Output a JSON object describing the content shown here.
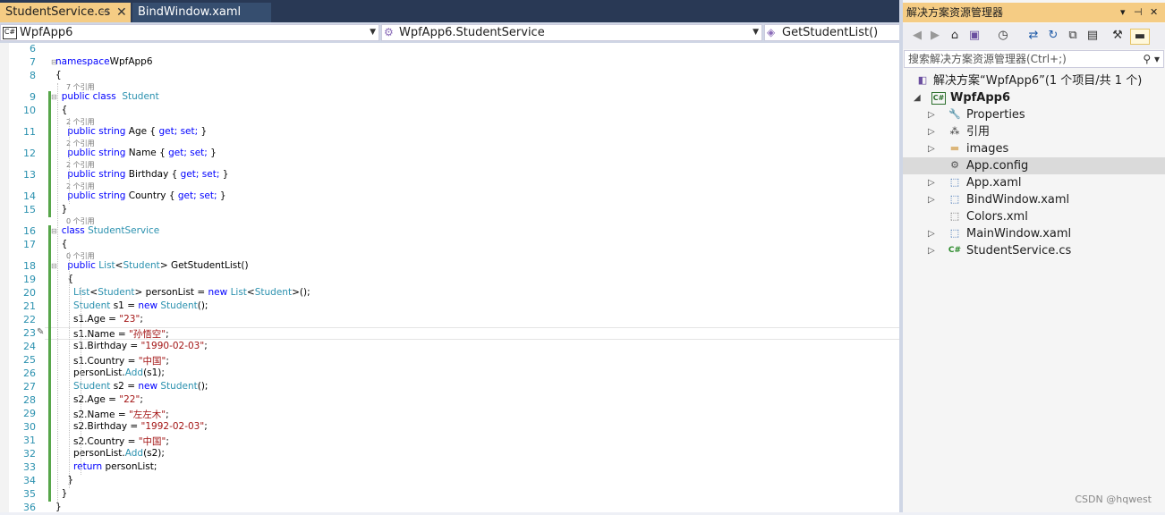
{
  "tabs": [
    {
      "label": "StudentService.cs",
      "active": true
    },
    {
      "label": "BindWindow.xaml",
      "active": false
    }
  ],
  "nav": {
    "project": "WpfApp6",
    "class": "WpfApp6.StudentService",
    "member": "GetStudentList()"
  },
  "lines": [
    {
      "n": "6",
      "tokens": []
    },
    {
      "n": "7",
      "tokens": [
        [
          "kw",
          "namespace"
        ],
        [
          "",
          "WpfApp6"
        ]
      ]
    },
    {
      "n": "8",
      "tokens": [
        [
          "",
          "{"
        ]
      ]
    },
    {
      "ref": "7 个引用"
    },
    {
      "n": "9",
      "tokens": [
        [
          "",
          "  "
        ],
        [
          "kw",
          "public class"
        ],
        [
          "",
          "  "
        ],
        [
          "ty",
          "Student"
        ]
      ]
    },
    {
      "n": "10",
      "tokens": [
        [
          "",
          "  {"
        ]
      ]
    },
    {
      "ref": "2 个引用"
    },
    {
      "n": "11",
      "tokens": [
        [
          "",
          "    "
        ],
        [
          "kw",
          "public string"
        ],
        [
          "",
          " Age { "
        ],
        [
          "kw",
          "get; set;"
        ],
        [
          "",
          " }"
        ]
      ]
    },
    {
      "ref": "2 个引用"
    },
    {
      "n": "12",
      "tokens": [
        [
          "",
          "    "
        ],
        [
          "kw",
          "public string"
        ],
        [
          "",
          " Name { "
        ],
        [
          "kw",
          "get; set;"
        ],
        [
          "",
          " }"
        ]
      ]
    },
    {
      "ref": "2 个引用"
    },
    {
      "n": "13",
      "tokens": [
        [
          "",
          "    "
        ],
        [
          "kw",
          "public string"
        ],
        [
          "",
          " Birthday { "
        ],
        [
          "kw",
          "get; set;"
        ],
        [
          "",
          " }"
        ]
      ]
    },
    {
      "ref": "2 个引用"
    },
    {
      "n": "14",
      "tokens": [
        [
          "",
          "    "
        ],
        [
          "kw",
          "public string"
        ],
        [
          "",
          " Country { "
        ],
        [
          "kw",
          "get; set;"
        ],
        [
          "",
          " }"
        ]
      ]
    },
    {
      "n": "15",
      "tokens": [
        [
          "",
          "  }"
        ]
      ]
    },
    {
      "ref": "0 个引用"
    },
    {
      "n": "16",
      "tokens": [
        [
          "",
          "  "
        ],
        [
          "kw",
          "class"
        ],
        [
          "",
          " "
        ],
        [
          "ty",
          "StudentService"
        ]
      ]
    },
    {
      "n": "17",
      "tokens": [
        [
          "",
          "  {"
        ]
      ]
    },
    {
      "ref": "0 个引用"
    },
    {
      "n": "18",
      "tokens": [
        [
          "",
          "    "
        ],
        [
          "kw",
          "public"
        ],
        [
          "",
          " "
        ],
        [
          "ty",
          "List"
        ],
        [
          "",
          "<"
        ],
        [
          "ty",
          "Student"
        ],
        [
          "",
          "> GetStudentList()"
        ]
      ]
    },
    {
      "n": "19",
      "tokens": [
        [
          "",
          "    {"
        ]
      ]
    },
    {
      "n": "20",
      "tokens": [
        [
          "",
          "      "
        ],
        [
          "ty",
          "List"
        ],
        [
          "",
          "<"
        ],
        [
          "ty",
          "Student"
        ],
        [
          "",
          "> personList = "
        ],
        [
          "kw",
          "new"
        ],
        [
          "",
          " "
        ],
        [
          "ty",
          "List"
        ],
        [
          "",
          "<"
        ],
        [
          "ty",
          "Student"
        ],
        [
          "",
          ">();"
        ]
      ]
    },
    {
      "n": "21",
      "tokens": [
        [
          "",
          "      "
        ],
        [
          "ty",
          "Student"
        ],
        [
          "",
          " s1 = "
        ],
        [
          "kw",
          "new"
        ],
        [
          "",
          " "
        ],
        [
          "ty",
          "Student"
        ],
        [
          "",
          "();"
        ]
      ]
    },
    {
      "n": "22",
      "tokens": [
        [
          "",
          "      s1.Age = "
        ],
        [
          "st",
          "\"23\""
        ],
        [
          "",
          ";"
        ]
      ]
    },
    {
      "n": "23",
      "tokens": [
        [
          "",
          "      s1.Name = "
        ],
        [
          "st",
          "\"孙悟空\""
        ],
        [
          "",
          ";"
        ]
      ]
    },
    {
      "n": "24",
      "tokens": [
        [
          "",
          "      s1.Birthday = "
        ],
        [
          "st",
          "\"1990-02-03\""
        ],
        [
          "",
          ";"
        ]
      ]
    },
    {
      "n": "25",
      "tokens": [
        [
          "",
          "      s1.Country = "
        ],
        [
          "st",
          "\"中国\""
        ],
        [
          "",
          ";"
        ]
      ]
    },
    {
      "n": "26",
      "tokens": [
        [
          "",
          "      personList."
        ],
        [
          "ty",
          "Add"
        ],
        [
          "",
          "(s1);"
        ]
      ]
    },
    {
      "n": "27",
      "tokens": [
        [
          "",
          "      "
        ],
        [
          "ty",
          "Student"
        ],
        [
          "",
          " s2 = "
        ],
        [
          "kw",
          "new"
        ],
        [
          "",
          " "
        ],
        [
          "ty",
          "Student"
        ],
        [
          "",
          "();"
        ]
      ]
    },
    {
      "n": "28",
      "tokens": [
        [
          "",
          "      s2.Age = "
        ],
        [
          "st",
          "\"22\""
        ],
        [
          "",
          ";"
        ]
      ]
    },
    {
      "n": "29",
      "tokens": [
        [
          "",
          "      s2.Name = "
        ],
        [
          "st",
          "\"左左木\""
        ],
        [
          "",
          ";"
        ]
      ]
    },
    {
      "n": "30",
      "tokens": [
        [
          "",
          "      s2.Birthday = "
        ],
        [
          "st",
          "\"1992-02-03\""
        ],
        [
          "",
          ";"
        ]
      ]
    },
    {
      "n": "31",
      "tokens": [
        [
          "",
          "      s2.Country = "
        ],
        [
          "st",
          "\"中国\""
        ],
        [
          "",
          ";"
        ]
      ]
    },
    {
      "n": "32",
      "tokens": [
        [
          "",
          "      personList."
        ],
        [
          "ty",
          "Add"
        ],
        [
          "",
          "(s2);"
        ]
      ]
    },
    {
      "n": "33",
      "tokens": [
        [
          "",
          "      "
        ],
        [
          "kw",
          "return"
        ],
        [
          "",
          " personList;"
        ]
      ]
    },
    {
      "n": "34",
      "tokens": [
        [
          "",
          "    }"
        ]
      ]
    },
    {
      "n": "35",
      "tokens": [
        [
          "",
          "  }"
        ]
      ]
    },
    {
      "n": "36",
      "tokens": [
        [
          "",
          "}"
        ]
      ]
    }
  ],
  "solution_explorer": {
    "title": "解决方案资源管理器",
    "search_placeholder": "搜索解决方案资源管理器(Ctrl+;)",
    "solution": "解决方案“WpfApp6”(1 个项目/共 1 个)",
    "project": "WpfApp6",
    "items": [
      {
        "label": "Properties",
        "icon": "wrench-icon",
        "expandable": true
      },
      {
        "label": "引用",
        "icon": "references-icon",
        "expandable": true
      },
      {
        "label": "images",
        "icon": "folder-icon",
        "expandable": true
      },
      {
        "label": "App.config",
        "icon": "config-file-icon",
        "expandable": false,
        "selected": true
      },
      {
        "label": "App.xaml",
        "icon": "xaml-file-icon",
        "expandable": true
      },
      {
        "label": "BindWindow.xaml",
        "icon": "xaml-file-icon",
        "expandable": true
      },
      {
        "label": "Colors.xml",
        "icon": "xml-file-icon",
        "expandable": false
      },
      {
        "label": "MainWindow.xaml",
        "icon": "xaml-file-icon",
        "expandable": true
      },
      {
        "label": "StudentService.cs",
        "icon": "csharp-file-icon",
        "expandable": true
      }
    ]
  },
  "watermark": "CSDN @hqwest",
  "colors": {
    "keyword": "#0000ff",
    "type": "#2b91af",
    "string": "#a31515",
    "active_tab": "#f5cc84"
  }
}
